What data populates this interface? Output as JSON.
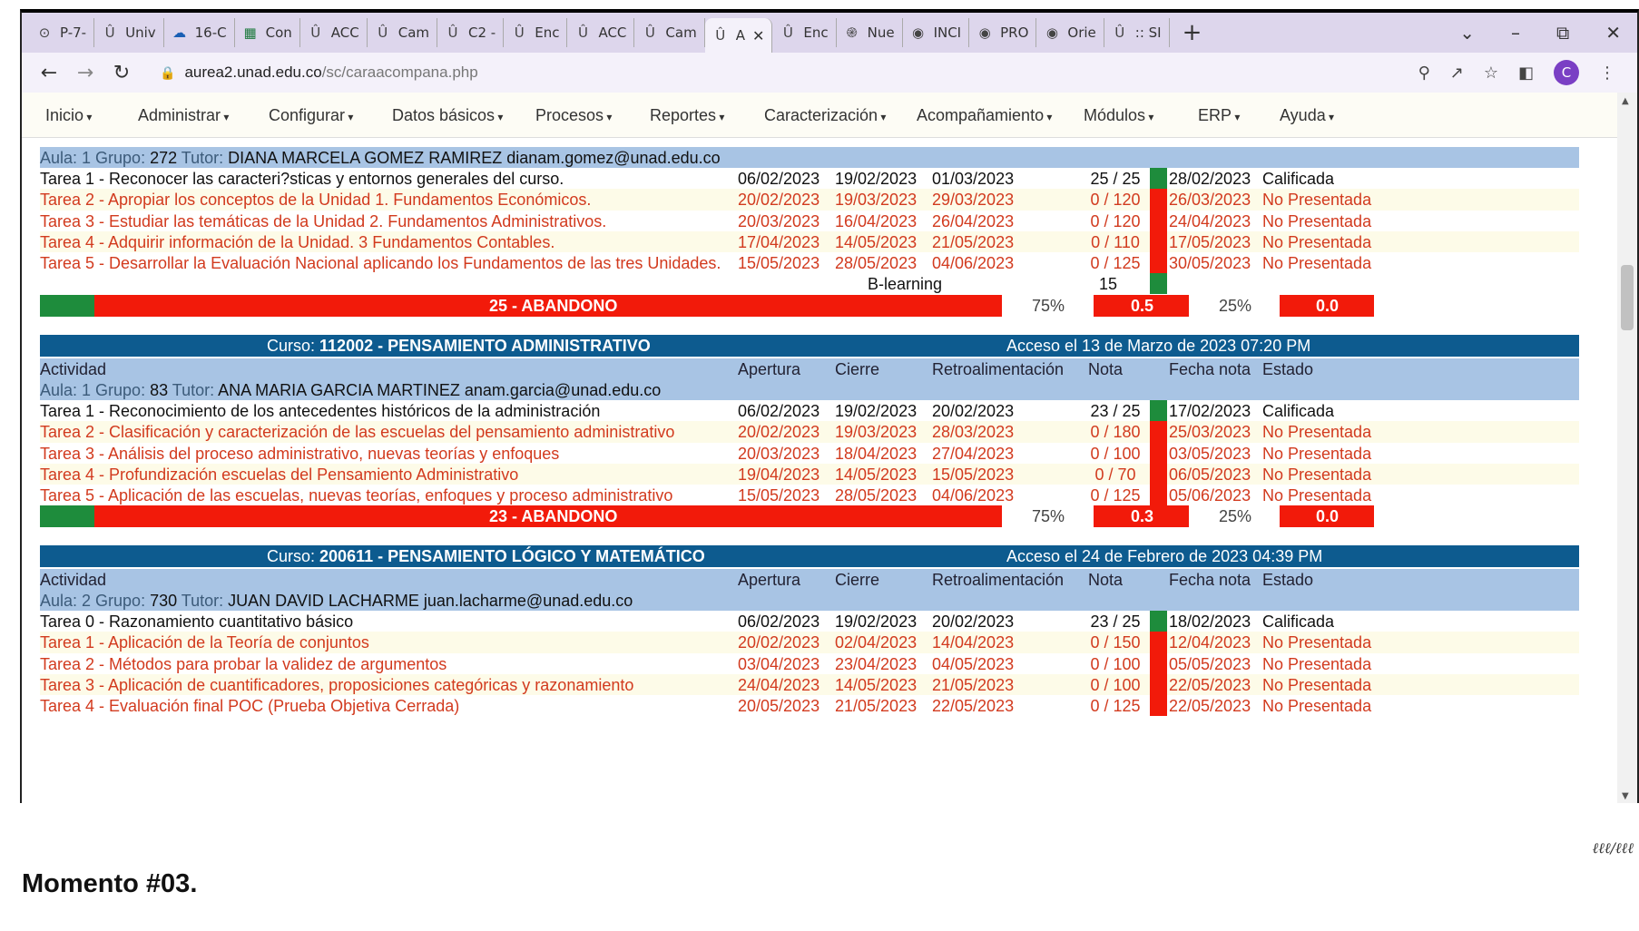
{
  "browser": {
    "tabs": [
      {
        "label": "P-7-",
        "icon": "github-icon"
      },
      {
        "label": "Univ",
        "icon": "unad-icon"
      },
      {
        "label": "16-C",
        "icon": "onedrive-icon"
      },
      {
        "label": "Con",
        "icon": "excel-icon"
      },
      {
        "label": "ACC",
        "icon": "unad-icon"
      },
      {
        "label": "Cam",
        "icon": "unad-icon"
      },
      {
        "label": "C2 -",
        "icon": "unad-icon"
      },
      {
        "label": "Enc",
        "icon": "unad-icon"
      },
      {
        "label": "ACC",
        "icon": "unad-icon"
      },
      {
        "label": "Cam",
        "icon": "unad-icon"
      },
      {
        "label": "A",
        "icon": "unad-icon",
        "active": true
      },
      {
        "label": "Enc",
        "icon": "unad-icon"
      },
      {
        "label": "Nue",
        "icon": "openai-icon"
      },
      {
        "label": "INCI",
        "icon": "chrome-icon"
      },
      {
        "label": "PRO",
        "icon": "chrome-icon"
      },
      {
        "label": "Orie",
        "icon": "chrome-icon"
      },
      {
        "label": ":: SI",
        "icon": "unad-icon"
      }
    ],
    "url_host": "aurea2.unad.edu.co",
    "url_path": "/sc/caraacompana.php",
    "profile_initial": "C"
  },
  "menu": [
    "Inicio",
    "Administrar",
    "Configurar",
    "Datos básicos",
    "Procesos",
    "Reportes",
    "Caracterización",
    "Acompañamiento",
    "Módulos",
    "ERP",
    "Ayuda"
  ],
  "course1": {
    "aula_label": "Aula: 1 Grupo: ",
    "grupo": "272",
    "tutor_label": " Tutor: ",
    "tutor": "DIANA MARCELA GOMEZ RAMIREZ dianam.gomez@unad.edu.co",
    "rows": [
      {
        "actividad": "Tarea 1 - Reconocer las caracteri?sticas y entornos generales del curso.",
        "apertura": "06/02/2023",
        "cierre": "19/02/2023",
        "retro": "01/03/2023",
        "nota": "25 / 25",
        "fecha": "28/02/2023",
        "estado": "Calificada",
        "ok": true
      },
      {
        "actividad": "Tarea 2 - Apropiar los conceptos de la Unidad 1. Fundamentos Económicos.",
        "apertura": "20/02/2023",
        "cierre": "19/03/2023",
        "retro": "29/03/2023",
        "nota": "0 / 120",
        "fecha": "26/03/2023",
        "estado": "No Presentada",
        "ok": false
      },
      {
        "actividad": "Tarea 3 - Estudiar las temáticas de la Unidad 2. Fundamentos Administrativos.",
        "apertura": "20/03/2023",
        "cierre": "16/04/2023",
        "retro": "26/04/2023",
        "nota": "0 / 120",
        "fecha": "24/04/2023",
        "estado": "No Presentada",
        "ok": false
      },
      {
        "actividad": "Tarea 4 - Adquirir información de la Unidad. 3 Fundamentos Contables.",
        "apertura": "17/04/2023",
        "cierre": "14/05/2023",
        "retro": "21/05/2023",
        "nota": "0 / 110",
        "fecha": "17/05/2023",
        "estado": "No Presentada",
        "ok": false
      },
      {
        "actividad": "Tarea 5 - Desarrollar la Evaluación Nacional aplicando los Fundamentos de las tres Unidades.",
        "apertura": "15/05/2023",
        "cierre": "28/05/2023",
        "retro": "04/06/2023",
        "nota": "0 / 125",
        "fecha": "30/05/2023",
        "estado": "No Presentada",
        "ok": false
      }
    ],
    "blearning_label": "B-learning",
    "blearning_value": "15",
    "summary": "25 - ABANDONO",
    "pct1": "75%",
    "score1": "0.5",
    "pct2": "25%",
    "score2": "0.0"
  },
  "table_headers": {
    "actividad": "Actividad",
    "apertura": "Apertura",
    "cierre": "Cierre",
    "retro": "Retroalimentación",
    "nota": "Nota",
    "fecha": "Fecha nota",
    "estado": "Estado"
  },
  "course2": {
    "curso_label": "Curso: ",
    "curso": "112002 - PENSAMIENTO ADMINISTRATIVO",
    "acceso": "Acceso el 13 de Marzo de 2023 07:20 PM",
    "aula_label": "Aula: 1 Grupo: ",
    "grupo": "83",
    "tutor_label": " Tutor: ",
    "tutor": "ANA MARIA GARCIA MARTINEZ anam.garcia@unad.edu.co",
    "rows": [
      {
        "actividad": "Tarea 1 - Reconocimiento de los antecedentes históricos de la administración",
        "apertura": "06/02/2023",
        "cierre": "19/02/2023",
        "retro": "20/02/2023",
        "nota": "23 / 25",
        "fecha": "17/02/2023",
        "estado": "Calificada",
        "ok": true
      },
      {
        "actividad": "Tarea 2 - Clasificación y caracterización de las escuelas del pensamiento administrativo",
        "apertura": "20/02/2023",
        "cierre": "19/03/2023",
        "retro": "28/03/2023",
        "nota": "0 / 180",
        "fecha": "25/03/2023",
        "estado": "No Presentada",
        "ok": false
      },
      {
        "actividad": "Tarea 3 - Análisis del proceso administrativo, nuevas teorías y enfoques",
        "apertura": "20/03/2023",
        "cierre": "18/04/2023",
        "retro": "27/04/2023",
        "nota": "0 / 100",
        "fecha": "03/05/2023",
        "estado": "No Presentada",
        "ok": false
      },
      {
        "actividad": "Tarea 4 - Profundización escuelas del Pensamiento Administrativo",
        "apertura": "19/04/2023",
        "cierre": "14/05/2023",
        "retro": "15/05/2023",
        "nota": "0 / 70",
        "fecha": "06/05/2023",
        "estado": "No Presentada",
        "ok": false
      },
      {
        "actividad": "Tarea 5 - Aplicación de las escuelas, nuevas teorías, enfoques y proceso administrativo",
        "apertura": "15/05/2023",
        "cierre": "28/05/2023",
        "retro": "04/06/2023",
        "nota": "0 / 125",
        "fecha": "05/06/2023",
        "estado": "No Presentada",
        "ok": false
      }
    ],
    "summary": "23 - ABANDONO",
    "pct1": "75%",
    "score1": "0.3",
    "pct2": "25%",
    "score2": "0.0"
  },
  "course3": {
    "curso_label": "Curso: ",
    "curso": "200611 - PENSAMIENTO LÓGICO Y MATEMÁTICO",
    "acceso": "Acceso el 24 de Febrero de 2023 04:39 PM",
    "aula_label": "Aula: 2 Grupo: ",
    "grupo": "730",
    "tutor_label": " Tutor: ",
    "tutor": "JUAN DAVID LACHARME juan.lacharme@unad.edu.co",
    "rows": [
      {
        "actividad": "Tarea 0 - Razonamiento cuantitativo básico",
        "apertura": "06/02/2023",
        "cierre": "19/02/2023",
        "retro": "20/02/2023",
        "nota": "23 / 25",
        "fecha": "18/02/2023",
        "estado": "Calificada",
        "ok": true
      },
      {
        "actividad": "Tarea 1 - Aplicación de la Teoría de conjuntos",
        "apertura": "20/02/2023",
        "cierre": "02/04/2023",
        "retro": "14/04/2023",
        "nota": "0 / 150",
        "fecha": "12/04/2023",
        "estado": "No Presentada",
        "ok": false
      },
      {
        "actividad": "Tarea 2 - Métodos para probar la validez de argumentos",
        "apertura": "03/04/2023",
        "cierre": "23/04/2023",
        "retro": "04/05/2023",
        "nota": "0 / 100",
        "fecha": "05/05/2023",
        "estado": "No Presentada",
        "ok": false
      },
      {
        "actividad": "Tarea 3 - Aplicación de cuantificadores, proposiciones categóricas y razonamiento",
        "apertura": "24/04/2023",
        "cierre": "14/05/2023",
        "retro": "21/05/2023",
        "nota": "0 / 100",
        "fecha": "22/05/2023",
        "estado": "No Presentada",
        "ok": false
      },
      {
        "actividad": "Tarea 4 - Evaluación final POC (Prueba Objetiva Cerrada)",
        "apertura": "20/05/2023",
        "cierre": "21/05/2023",
        "retro": "22/05/2023",
        "nota": "0 / 125",
        "fecha": "22/05/2023",
        "estado": "No Presentada",
        "ok": false
      }
    ]
  },
  "caption": "Momento #03.",
  "colors": {
    "header_band": "#a8c4e4",
    "title_band": "#0d5b8f",
    "fail_red": "#f21a0a",
    "ok_green": "#1e8c3c",
    "row_text_red": "#d23a1e"
  }
}
